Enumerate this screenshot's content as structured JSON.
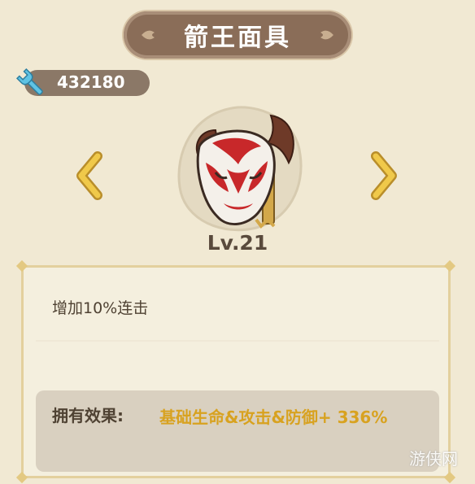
{
  "title": "箭王面具",
  "currency": {
    "icon": "wrench-icon",
    "value": "432180"
  },
  "item": {
    "icon": "demon-mask-icon",
    "level": "Lv.21"
  },
  "navigation": {
    "prev_icon": "chevron-left-icon",
    "next_icon": "chevron-right-icon"
  },
  "description": "增加10%连击",
  "effect": {
    "label": "拥有效果:",
    "value": "基础生命&攻击&防御+ 336%"
  },
  "watermark": "游侠网",
  "colors": {
    "background": "#f1e9d3",
    "banner": "#8a6d58",
    "accent_gold": "#d8a220",
    "text_dark": "#4f4233"
  }
}
